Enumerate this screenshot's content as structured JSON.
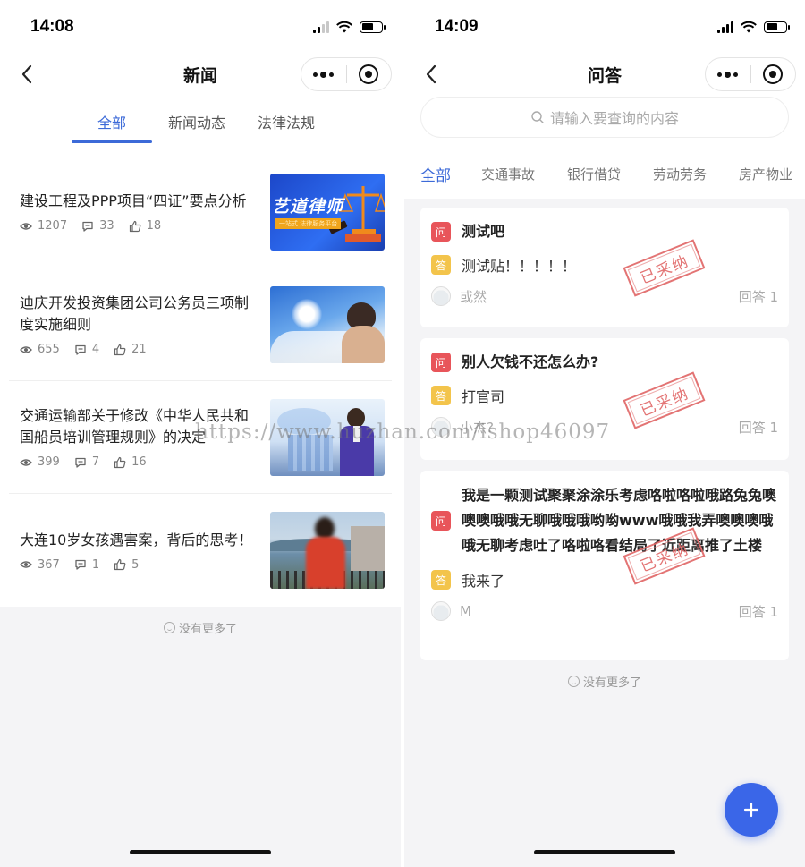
{
  "left": {
    "status": {
      "time": "14:08"
    },
    "nav": {
      "title": "新闻"
    },
    "tabs": [
      "全部",
      "新闻动态",
      "法律法规"
    ],
    "news": [
      {
        "title": "建设工程及PPP项目“四证”要点分析",
        "views": "1207",
        "comments": "33",
        "likes": "18",
        "thumb_text": "艺道律师",
        "thumb_sub": "一站式 法律服务平台"
      },
      {
        "title": "迪庆开发投资集团公司公务员三项制度实施细则",
        "views": "655",
        "comments": "4",
        "likes": "21"
      },
      {
        "title": "交通运输部关于修改《中华人民共和国船员培训管理规则》的决定",
        "views": "399",
        "comments": "7",
        "likes": "16"
      },
      {
        "title": "大连10岁女孩遇害案，背后的思考！",
        "views": "367",
        "comments": "1",
        "likes": "5"
      }
    ],
    "no_more": "没有更多了"
  },
  "right": {
    "status": {
      "time": "14:09"
    },
    "nav": {
      "title": "问答"
    },
    "search": {
      "placeholder": "请输入要查询的内容"
    },
    "tabs": [
      "全部",
      "交通事故",
      "银行借贷",
      "劳动劳务",
      "房产物业"
    ],
    "questions": [
      {
        "q_badge": "问",
        "question": "测试吧",
        "a_badge": "答",
        "answer": "测试贴！！！！！",
        "user": "或然",
        "answers": "回答  1",
        "stamp": "已采纳"
      },
      {
        "q_badge": "问",
        "question": "别人欠钱不还怎么办?",
        "a_badge": "答",
        "answer": "打官司",
        "user": "小杰?",
        "answers": "回答  1",
        "stamp": "已采纳"
      },
      {
        "q_badge": "问",
        "question": "我是一颗测试聚聚涂涂乐考虑咯啦咯啦哦路兔兔噢噢噢哦哦无聊哦哦哦哟哟www哦哦我弄噢噢噢哦哦无聊考虑吐了咯啦咯看结局了近距离推了土楼",
        "a_badge": "答",
        "answer": "我来了",
        "user": "M",
        "answers": "回答  1",
        "stamp": "已采纳"
      }
    ],
    "no_more": "没有更多了"
  },
  "watermark": "https://www.huzhan.com/ishop46097",
  "colors": {
    "accent": "#3c6ad8",
    "question_badge": "#e8555a",
    "answer_badge": "#f3c44b",
    "stamp": "#e06565",
    "fab": "#3a66e8"
  }
}
